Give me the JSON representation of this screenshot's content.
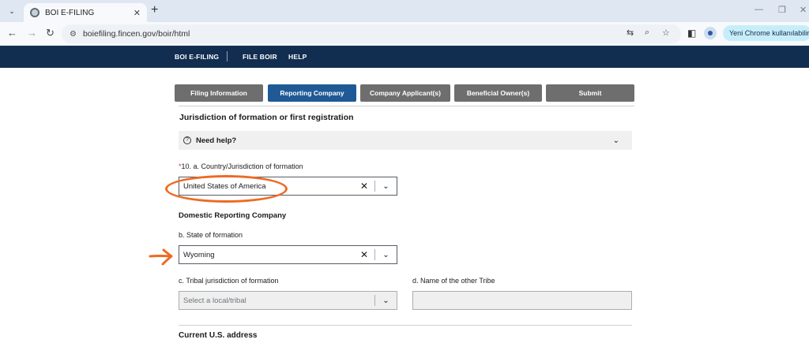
{
  "browser": {
    "tab_title": "BOI E-FILING",
    "url": "boiefiling.fincen.gov/boir/html",
    "chrome_pill": "Yeni Chrome kullanılabilir"
  },
  "site_nav": {
    "items": [
      "BOI E-FILING",
      "FILE BOIR",
      "HELP"
    ]
  },
  "steps": [
    {
      "label": "Filing Information",
      "active": false
    },
    {
      "label": "Reporting Company",
      "active": true
    },
    {
      "label": "Company Applicant(s)",
      "active": false
    },
    {
      "label": "Beneficial Owner(s)",
      "active": false
    },
    {
      "label": "Submit",
      "active": false
    }
  ],
  "form": {
    "section_jurisdiction": "Jurisdiction of formation or first registration",
    "help_label": "Need help?",
    "country_required_marker": "*",
    "country_label": "10. a. Country/Jurisdiction of formation",
    "country_value": "United States of America",
    "domestic_heading": "Domestic Reporting Company",
    "state_label": "b. State of formation",
    "state_value": "Wyoming",
    "tribal_label": "c. Tribal jurisdiction of formation",
    "tribal_placeholder": "Select a local/tribal",
    "other_tribe_label": "d. Name of the other Tribe",
    "other_tribe_value": "",
    "address_heading": "Current U.S. address"
  },
  "annotation_color": "#ee6a24",
  "accent_color": "#1f5a96",
  "nav_color": "#112e51"
}
